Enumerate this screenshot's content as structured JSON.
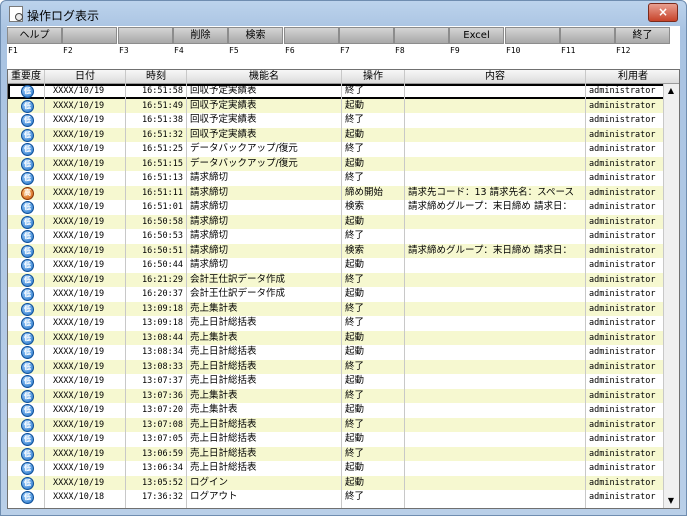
{
  "window": {
    "title": "操作ログ表示",
    "close_label": "×"
  },
  "fkeys": [
    {
      "label": "ヘルプ",
      "key": "F1"
    },
    {
      "label": "",
      "key": "F2"
    },
    {
      "label": "",
      "key": "F3"
    },
    {
      "label": "削除",
      "key": "F4"
    },
    {
      "label": "検索",
      "key": "F5"
    },
    {
      "label": "",
      "key": "F6"
    },
    {
      "label": "",
      "key": "F7"
    },
    {
      "label": "",
      "key": "F8"
    },
    {
      "label": "Excel",
      "key": "F9"
    },
    {
      "label": "",
      "key": "F10"
    },
    {
      "label": "",
      "key": "F11"
    },
    {
      "label": "終了",
      "key": "F12"
    }
  ],
  "columns": [
    "重要度",
    "日付",
    "時刻",
    "機能名",
    "操作",
    "内容",
    "利用者"
  ],
  "severity_labels": {
    "low": "低",
    "high": "高"
  },
  "rows": [
    {
      "sev": "low",
      "date": "XXXX/10/19",
      "time": "16:51:58",
      "func": "回収予定実績表",
      "op": "終了",
      "content": "",
      "user": "administrator"
    },
    {
      "sev": "low",
      "date": "XXXX/10/19",
      "time": "16:51:49",
      "func": "回収予定実績表",
      "op": "起動",
      "content": "",
      "user": "administrator"
    },
    {
      "sev": "low",
      "date": "XXXX/10/19",
      "time": "16:51:38",
      "func": "回収予定実績表",
      "op": "終了",
      "content": "",
      "user": "administrator"
    },
    {
      "sev": "low",
      "date": "XXXX/10/19",
      "time": "16:51:32",
      "func": "回収予定実績表",
      "op": "起動",
      "content": "",
      "user": "administrator"
    },
    {
      "sev": "low",
      "date": "XXXX/10/19",
      "time": "16:51:25",
      "func": "データバックアップ/復元",
      "op": "終了",
      "content": "",
      "user": "administrator"
    },
    {
      "sev": "low",
      "date": "XXXX/10/19",
      "time": "16:51:15",
      "func": "データバックアップ/復元",
      "op": "起動",
      "content": "",
      "user": "administrator"
    },
    {
      "sev": "low",
      "date": "XXXX/10/19",
      "time": "16:51:13",
      "func": "請求締切",
      "op": "終了",
      "content": "",
      "user": "administrator"
    },
    {
      "sev": "high",
      "date": "XXXX/10/19",
      "time": "16:51:11",
      "func": "請求締切",
      "op": "締め開始",
      "content": "請求先コード：13 請求先名：スペース",
      "user": "administrator"
    },
    {
      "sev": "low",
      "date": "XXXX/10/19",
      "time": "16:51:01",
      "func": "請求締切",
      "op": "検索",
      "content": "請求締めグループ：末日締め 請求日：",
      "user": "administrator"
    },
    {
      "sev": "low",
      "date": "XXXX/10/19",
      "time": "16:50:58",
      "func": "請求締切",
      "op": "起動",
      "content": "",
      "user": "administrator"
    },
    {
      "sev": "low",
      "date": "XXXX/10/19",
      "time": "16:50:53",
      "func": "請求締切",
      "op": "終了",
      "content": "",
      "user": "administrator"
    },
    {
      "sev": "low",
      "date": "XXXX/10/19",
      "time": "16:50:51",
      "func": "請求締切",
      "op": "検索",
      "content": "請求締めグループ：末日締め 請求日：",
      "user": "administrator"
    },
    {
      "sev": "low",
      "date": "XXXX/10/19",
      "time": "16:50:44",
      "func": "請求締切",
      "op": "起動",
      "content": "",
      "user": "administrator"
    },
    {
      "sev": "low",
      "date": "XXXX/10/19",
      "time": "16:21:29",
      "func": "会計王仕訳データ作成",
      "op": "終了",
      "content": "",
      "user": "administrator"
    },
    {
      "sev": "low",
      "date": "XXXX/10/19",
      "time": "16:20:37",
      "func": "会計王仕訳データ作成",
      "op": "起動",
      "content": "",
      "user": "administrator"
    },
    {
      "sev": "low",
      "date": "XXXX/10/19",
      "time": "13:09:18",
      "func": "売上集計表",
      "op": "終了",
      "content": "",
      "user": "administrator"
    },
    {
      "sev": "low",
      "date": "XXXX/10/19",
      "time": "13:09:18",
      "func": "売上日計総括表",
      "op": "終了",
      "content": "",
      "user": "administrator"
    },
    {
      "sev": "low",
      "date": "XXXX/10/19",
      "time": "13:08:44",
      "func": "売上集計表",
      "op": "起動",
      "content": "",
      "user": "administrator"
    },
    {
      "sev": "low",
      "date": "XXXX/10/19",
      "time": "13:08:34",
      "func": "売上日計総括表",
      "op": "起動",
      "content": "",
      "user": "administrator"
    },
    {
      "sev": "low",
      "date": "XXXX/10/19",
      "time": "13:08:33",
      "func": "売上日計総括表",
      "op": "終了",
      "content": "",
      "user": "administrator"
    },
    {
      "sev": "low",
      "date": "XXXX/10/19",
      "time": "13:07:37",
      "func": "売上日計総括表",
      "op": "起動",
      "content": "",
      "user": "administrator"
    },
    {
      "sev": "low",
      "date": "XXXX/10/19",
      "time": "13:07:36",
      "func": "売上集計表",
      "op": "終了",
      "content": "",
      "user": "administrator"
    },
    {
      "sev": "low",
      "date": "XXXX/10/19",
      "time": "13:07:20",
      "func": "売上集計表",
      "op": "起動",
      "content": "",
      "user": "administrator"
    },
    {
      "sev": "low",
      "date": "XXXX/10/19",
      "time": "13:07:08",
      "func": "売上日計総括表",
      "op": "終了",
      "content": "",
      "user": "administrator"
    },
    {
      "sev": "low",
      "date": "XXXX/10/19",
      "time": "13:07:05",
      "func": "売上日計総括表",
      "op": "起動",
      "content": "",
      "user": "administrator"
    },
    {
      "sev": "low",
      "date": "XXXX/10/19",
      "time": "13:06:59",
      "func": "売上日計総括表",
      "op": "終了",
      "content": "",
      "user": "administrator"
    },
    {
      "sev": "low",
      "date": "XXXX/10/19",
      "time": "13:06:34",
      "func": "売上日計総括表",
      "op": "起動",
      "content": "",
      "user": "administrator"
    },
    {
      "sev": "low",
      "date": "XXXX/10/19",
      "time": "13:05:52",
      "func": "ログイン",
      "op": "起動",
      "content": "",
      "user": "administrator"
    },
    {
      "sev": "low",
      "date": "XXXX/10/18",
      "time": "17:36:32",
      "func": "ログアウト",
      "op": "終了",
      "content": "",
      "user": "administrator"
    }
  ]
}
